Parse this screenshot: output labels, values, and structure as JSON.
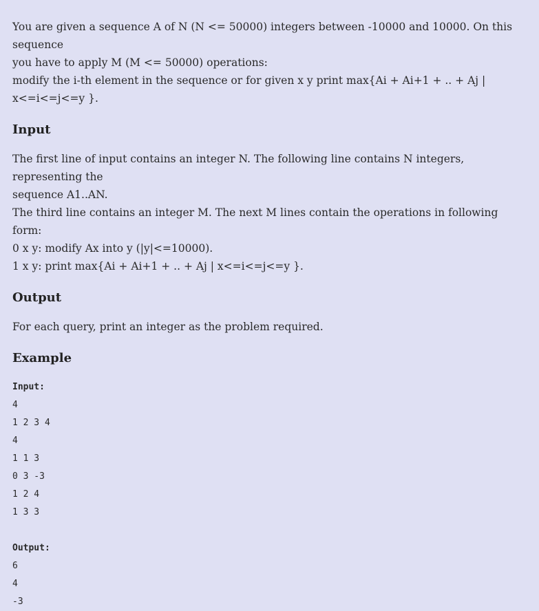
{
  "statement": {
    "lines": [
      "You are given a sequence A of N (N <= 50000) integers between -10000 and 10000. On this sequence",
      "you have to apply M (M <= 50000) operations:",
      "modify the i-th element in the sequence or for given x y print max{Ai + Ai+1 + .. + Aj | x<=i<=j<=y }."
    ]
  },
  "input_section": {
    "heading": "Input",
    "lines": [
      "The first line of input contains an integer N. The following line contains N integers, representing the",
      "sequence A1..AN.",
      "The third line contains an integer M. The next M lines contain the operations in following form:",
      "0 x y: modify Ax into y (|y|<=10000).",
      "1 x y: print max{Ai + Ai+1 + .. + Aj | x<=i<=j<=y }."
    ]
  },
  "output_section": {
    "heading": "Output",
    "text": "For each query, print an integer as the problem required."
  },
  "example_section": {
    "heading": "Example",
    "input_label": "Input:",
    "input_lines": [
      "4",
      "1 2 3 4",
      "4",
      "1 1 3",
      "0 3 -3",
      "1 2 4",
      "1 3 3"
    ],
    "output_label": "Output:",
    "output_lines": [
      "6",
      "4",
      "-3"
    ]
  }
}
